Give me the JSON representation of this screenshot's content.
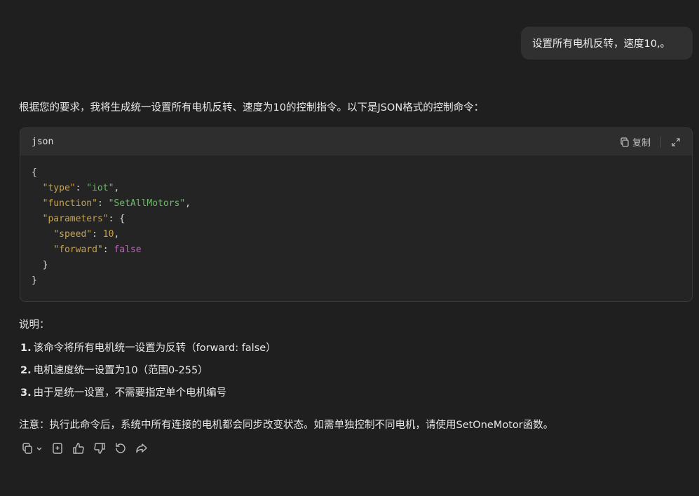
{
  "user_message": "设置所有电机反转，速度10,。",
  "assistant": {
    "intro": "根据您的要求，我将生成统一设置所有电机反转、速度为10的控制指令。以下是JSON格式的控制命令：",
    "code_block": {
      "language": "json",
      "copy_label": "复制",
      "lines": [
        "{",
        "  \"type\": \"iot\",",
        "  \"function\": \"SetAllMotors\",",
        "  \"parameters\": {",
        "    \"speed\": 10,",
        "    \"forward\": false",
        "  }",
        "}"
      ]
    },
    "explanation_title": "说明：",
    "explanation_items": [
      {
        "num": "1.",
        "text": "该命令将所有电机统一设置为反转（forward: false）"
      },
      {
        "num": "2.",
        "text": "电机速度统一设置为10（范围0-255）"
      },
      {
        "num": "3.",
        "text": "由于是统一设置，不需要指定单个电机编号"
      }
    ],
    "note": "注意：执行此命令后，系统中所有连接的电机都会同步改变状态。如需单独控制不同电机，请使用SetOneMotor函数。"
  },
  "toolbar_icons": [
    "copy-icon",
    "chevron-down-icon",
    "bookmark-icon",
    "thumbs-up-icon",
    "thumbs-down-icon",
    "regenerate-icon",
    "share-icon"
  ],
  "colors": {
    "background": "#1f1f1f",
    "bubble": "#303030",
    "code_key": "#c9a34a",
    "code_string": "#6fb86b",
    "code_boolean": "#c25fc2"
  }
}
